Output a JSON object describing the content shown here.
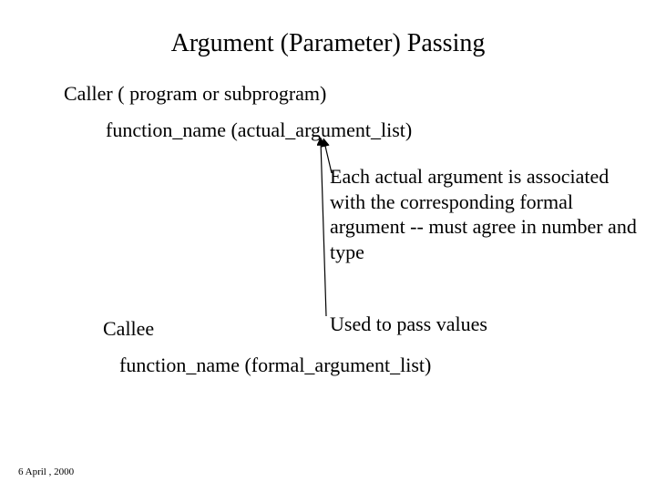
{
  "title": "Argument (Parameter) Passing",
  "caller_line": "Caller ( program or subprogram)",
  "caller_syntax": "function_name (actual_argument_list)",
  "explanation": "Each actual argument is associated with the corresponding formal argument -- must agree in number and type",
  "used_to": "Used to pass values",
  "callee_label": "Callee",
  "callee_syntax": "function_name (formal_argument_list)",
  "footer": "6 April , 2000"
}
